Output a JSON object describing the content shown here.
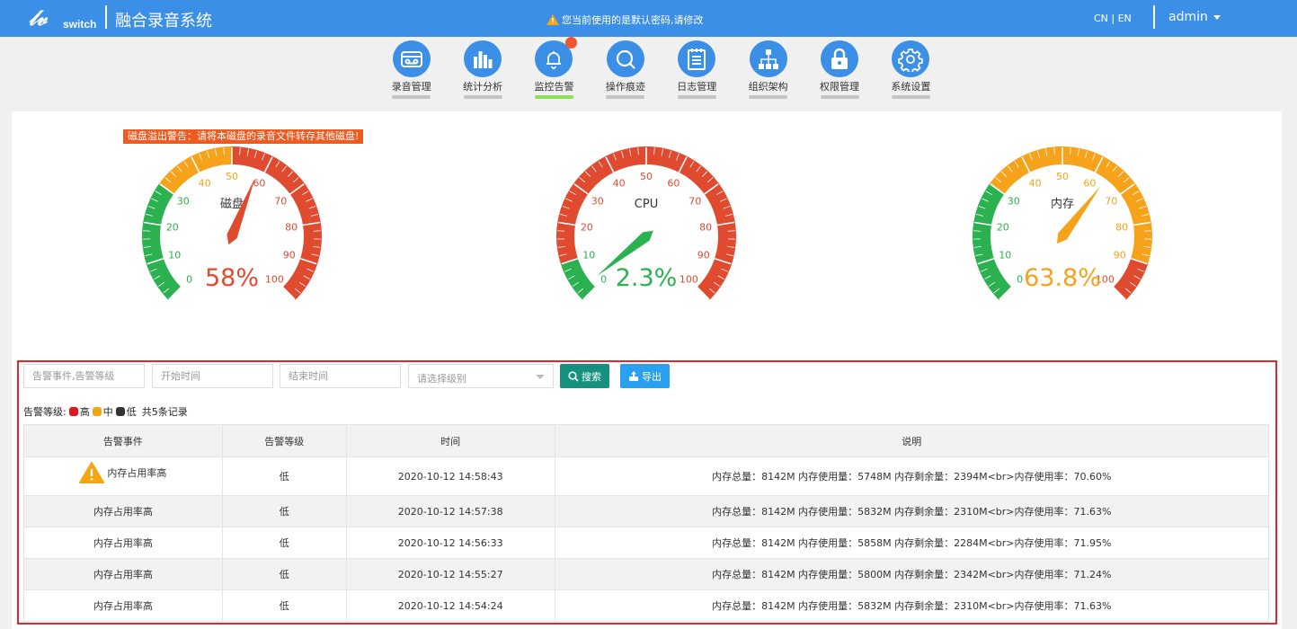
{
  "header": {
    "logo_text": "switch",
    "title": "融合录音系统",
    "warning": "您当前使用的是默认密码,请修改",
    "lang": "CN | EN",
    "user": "admin"
  },
  "nav": [
    {
      "label": "录音管理",
      "icon": "recorder-icon",
      "active": false
    },
    {
      "label": "统计分析",
      "icon": "bar-chart-icon",
      "active": false
    },
    {
      "label": "监控告警",
      "icon": "bell-icon",
      "active": true,
      "has_badge": true
    },
    {
      "label": "操作痕迹",
      "icon": "magnifier-icon",
      "active": false
    },
    {
      "label": "日志管理",
      "icon": "notepad-icon",
      "active": false
    },
    {
      "label": "组织架构",
      "icon": "org-tree-icon",
      "active": false
    },
    {
      "label": "权限管理",
      "icon": "lock-icon",
      "active": false
    },
    {
      "label": "系统设置",
      "icon": "gear-icon",
      "active": false
    }
  ],
  "disk_alert": "磁盘溢出警告：请将本磁盘的录音文件转存其他磁盘!",
  "gauges": [
    {
      "name": "磁盘",
      "value": 58,
      "display": "58%",
      "color": "#e04a2f",
      "min": 0,
      "max": 100
    },
    {
      "name": "CPU",
      "value": 2.3,
      "display": "2.3%",
      "color": "#2bb14f",
      "min": 0,
      "max": 100
    },
    {
      "name": "内存",
      "value": 63.8,
      "display": "63.8%",
      "color": "#f7a21b",
      "min": 0,
      "max": 100
    }
  ],
  "gauge_ticks": [
    "0",
    "10",
    "20",
    "30",
    "40",
    "50",
    "60",
    "70",
    "80",
    "90",
    "100"
  ],
  "colors": {
    "green": "#2bb14f",
    "orange": "#f7a21b",
    "red": "#e04a2f",
    "brand": "#3b8fe6"
  },
  "filters": {
    "event_placeholder": "告警事件,告警等级",
    "start_placeholder": "开始时间",
    "end_placeholder": "结束时间",
    "level_placeholder": "请选择级别",
    "search_label": "搜索",
    "export_label": "导出"
  },
  "legend": {
    "prefix": "告警等级:",
    "high": "高",
    "mid": "中",
    "low": "低",
    "total": "共5条记录",
    "high_color": "#e3141b",
    "mid_color": "#f5a60f",
    "low_color": "#333333"
  },
  "table": {
    "columns": [
      "告警事件",
      "告警等级",
      "时间",
      "说明"
    ],
    "rows": [
      {
        "event": "内存占用率高",
        "level": "低",
        "time": "2020-10-12 14:58:43",
        "desc": "内存总量：8142M 内存使用量：5748M 内存剩余量：2394M<br>内存使用率：70.60%",
        "icon": "warning-icon"
      },
      {
        "event": "内存占用率高",
        "level": "低",
        "time": "2020-10-12 14:57:38",
        "desc": "内存总量：8142M 内存使用量：5832M 内存剩余量：2310M<br>内存使用率：71.63%"
      },
      {
        "event": "内存占用率高",
        "level": "低",
        "time": "2020-10-12 14:56:33",
        "desc": "内存总量：8142M 内存使用量：5858M 内存剩余量：2284M<br>内存使用率：71.95%"
      },
      {
        "event": "内存占用率高",
        "level": "低",
        "time": "2020-10-12 14:55:27",
        "desc": "内存总量：8142M 内存使用量：5800M 内存剩余量：2342M<br>内存使用率：71.24%"
      },
      {
        "event": "内存占用率高",
        "level": "低",
        "time": "2020-10-12 14:54:24",
        "desc": "内存总量：8142M 内存使用量：5832M 内存剩余量：2310M<br>内存使用率：71.63%"
      }
    ]
  }
}
